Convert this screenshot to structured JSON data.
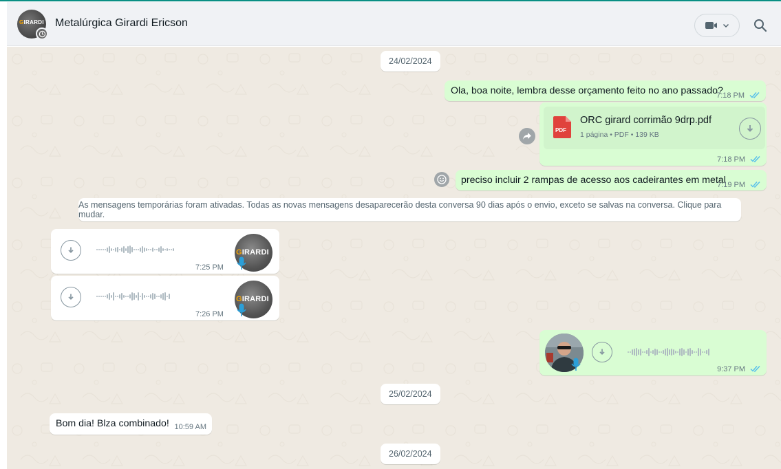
{
  "header": {
    "contact_name": "Metalúrgica Girardi Ericson",
    "avatar_text": "GIRARDI",
    "icons": [
      "timer-icon",
      "video-call-icon",
      "chevron-down-icon",
      "search-icon"
    ]
  },
  "colors": {
    "outgoing_bubble": "#d9fdd3",
    "incoming_bubble": "#ffffff",
    "chat_background": "#efeae2",
    "read_ticks": "#53bdeb",
    "pdf_red": "#e0423c"
  },
  "messages": {
    "date1": "24/02/2024",
    "m1_text": "Ola, boa noite, lembra desse orçamento feito no ano passado?",
    "m1_time": "7:18 PM",
    "m2_file_name": "ORC girard corrimão 9drp.pdf",
    "m2_file_meta": "1 página • PDF • 139 KB",
    "m2_pdf_badge": "PDF",
    "m2_time": "7:18 PM",
    "m3_text": "preciso incluir 2 rampas de acesso aos cadeirantes em metal",
    "m3_time": "7:19 PM",
    "system_notice": "As mensagens temporárias foram ativadas. Todas as novas mensagens desaparecerão desta conversa 90 dias após o envio, exceto se salvas na conversa. Clique para mudar.",
    "voice1_time": "7:25 PM",
    "voice1_avatar_text": "GIRARDI",
    "voice2_time": "7:26 PM",
    "voice2_avatar_text": "GIRARDI",
    "voice3_time": "9:37 PM",
    "date2": "25/02/2024",
    "m4_text": "Bom dia! Blza combinado!",
    "m4_time": "10:59 AM",
    "date3": "26/02/2024"
  }
}
